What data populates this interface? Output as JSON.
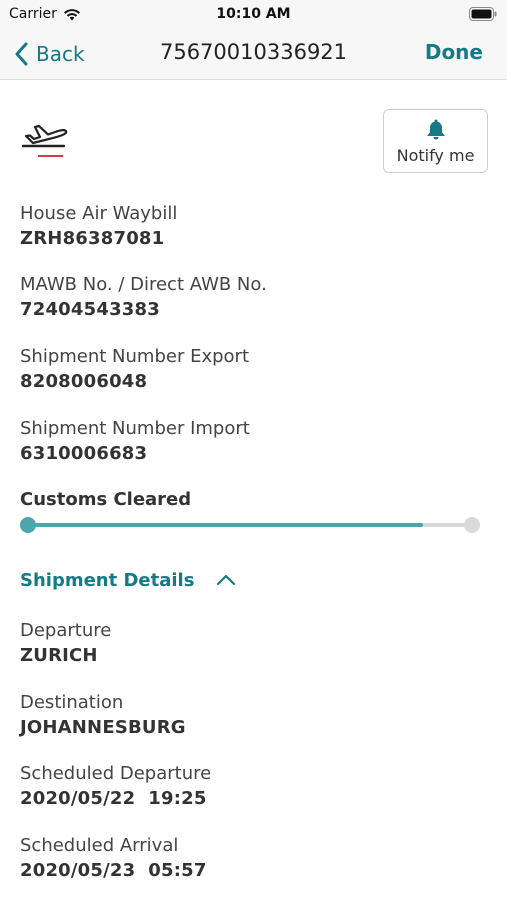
{
  "status_bar": {
    "carrier": "Carrier",
    "time": "10:10 AM"
  },
  "nav": {
    "back_label": "Back",
    "title": "75670010336921",
    "done_label": "Done"
  },
  "notify": {
    "label": "Notify me",
    "icon": "bell-icon"
  },
  "transport_icon": "airplane-icon",
  "fields": [
    {
      "label": "House Air Waybill",
      "value": "ZRH86387081"
    },
    {
      "label": "MAWB No. / Direct AWB No.",
      "value": "72404543383"
    },
    {
      "label": "Shipment Number Export",
      "value": "8208006048"
    },
    {
      "label": "Shipment Number Import",
      "value": "6310006683"
    }
  ],
  "status": {
    "label": "Customs Cleared",
    "progress_percent": 89
  },
  "details": {
    "title": "Shipment Details",
    "items": [
      {
        "label": "Departure",
        "value": "ZURICH"
      },
      {
        "label": "Destination",
        "value": "JOHANNESBURG"
      },
      {
        "label": "Scheduled Departure",
        "value": "2020/05/22  19:25"
      },
      {
        "label": "Scheduled Arrival",
        "value": "2020/05/23  05:57"
      }
    ]
  },
  "colors": {
    "accent": "#137a86",
    "progress": "#4ba6ad",
    "track": "#d9d9d9",
    "underline": "#d63a4a"
  }
}
